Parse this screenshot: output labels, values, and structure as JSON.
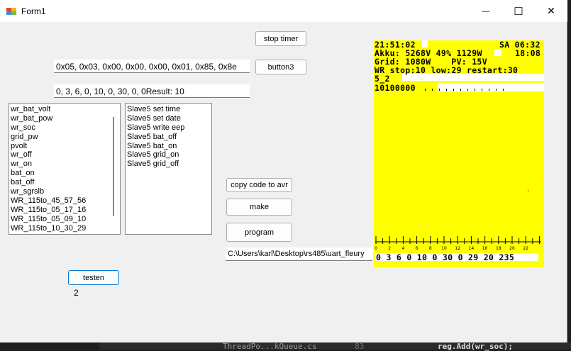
{
  "window": {
    "title": "Form1"
  },
  "titlebar": {
    "minimize_glyph": "—",
    "maximize_glyph": "☐",
    "close_glyph": "✕"
  },
  "buttons": {
    "stop_timer": "stop timer",
    "button3": "button3",
    "copy_code": "copy code to avr",
    "make": "make",
    "program": "program",
    "testen": "testen"
  },
  "textboxes": {
    "hex_bytes": "0x05, 0x03, 0x00, 0x00, 0x00, 0x01, 0x85, 0x8e",
    "result": "0, 3, 6, 0, 10, 0, 30, 0, 0Result: 10",
    "path": "C:\\Users\\karl\\Desktop\\rs485\\uart_fleury"
  },
  "list_left": [
    "wr_bat_volt",
    "wr_bat_pow",
    "wr_soc",
    "grid_pw",
    "pvolt",
    "wr_off",
    "wr_on",
    "bat_on",
    "bat_off",
    "wr_sgrslb",
    "WR_115to_45_57_56",
    "WR_115to_05_17_16",
    "WR_115to_05_09_10",
    "WR_115to_10_30_29"
  ],
  "list_right": [
    "Slave5 set time",
    "Slave5 set date",
    "Slave5 write eep",
    "Slave5 bat_off",
    "Slave5 bat_on",
    "Slave5 grid_on",
    "Slave5 grid_off"
  ],
  "counter_label": "2",
  "lcd": {
    "line1_left": "21:51:02",
    "line1_right": "SA 06:32",
    "line2_left": "Akku: 5268V 49% 1129W",
    "line2_right": "18:08",
    "line3": "Grid: 1080W    PV: 15V",
    "line4": "WR stop:10 low:29 restart:30",
    "line5": "5_2",
    "line6": "10100000",
    "bottom_values": "0 3 6 0 10 0 30 0 29 20 235",
    "axis_labels": [
      "0",
      "2",
      "4",
      "6",
      "8",
      "10",
      "12",
      "14",
      "16",
      "18",
      "20",
      "22"
    ],
    "background_color": "#ffff00"
  },
  "background_editor": {
    "tab_text": "ThreadPo...kQueue.cs",
    "line_number": "83",
    "code_text": "reg.Add(wr_soc);"
  }
}
